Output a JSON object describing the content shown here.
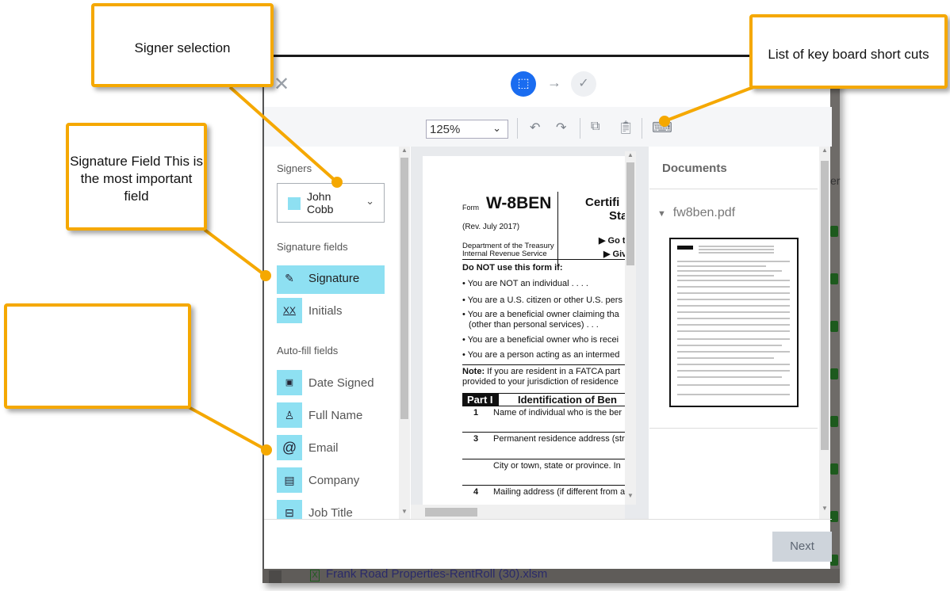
{
  "background": {
    "file_name": "Frank Road Properties-RentRoll (30).xlsm",
    "partial_text": "er"
  },
  "header": {
    "step_current": "select-fields",
    "step_next": "review"
  },
  "toolbar": {
    "zoom": "125%"
  },
  "left_panel": {
    "signers_label": "Signers",
    "signer_name": "John Cobb",
    "signer_color": "#8ee0f2",
    "signature_fields_label": "Signature fields",
    "signature_fields": [
      {
        "label": "Signature",
        "icon": "pen-icon",
        "selected": true
      },
      {
        "label": "Initials",
        "icon": "initials-icon",
        "selected": false
      }
    ],
    "autofill_label": "Auto-fill fields",
    "autofill_fields": [
      {
        "label": "Date Signed",
        "icon": "calendar-icon"
      },
      {
        "label": "Full Name",
        "icon": "person-icon"
      },
      {
        "label": "Email",
        "icon": "at-icon"
      },
      {
        "label": "Company",
        "icon": "building-icon"
      },
      {
        "label": "Job Title",
        "icon": "briefcase-icon"
      }
    ]
  },
  "document": {
    "form_label": "Form",
    "form_name": "W-8BEN",
    "title1": "Certifi",
    "title2": "Sta",
    "rev": "(Rev. July 2017)",
    "dept1": "Department of the Treasury",
    "dept2": "Internal Revenue Service",
    "go": "▶ Go t",
    "give": "▶ Giv",
    "do_not": "Do NOT use this form if:",
    "bullets": [
      "• You are NOT an individual  .  .  .  .",
      "• You are a U.S. citizen or other U.S. pers",
      "• You are a beneficial owner claiming tha",
      "(other than personal services)  .  .  .",
      "• You are a beneficial owner who is recei",
      "• You are a person acting as an intermed"
    ],
    "note_bold": "Note:",
    "note1": " If you are resident in a FATCA part",
    "note2": "provided to your jurisdiction of residence",
    "part": "Part I",
    "part_title": "Identification of Ben",
    "lines": [
      {
        "n": "1",
        "t": "Name of individual who is the ber"
      },
      {
        "n": "3",
        "t": "Permanent residence address (str"
      },
      {
        "n": "",
        "t": "City or town, state or province. In"
      },
      {
        "n": "4",
        "t": "Mailing address (if different from a"
      }
    ]
  },
  "right_panel": {
    "title": "Documents",
    "file": "fw8ben.pdf"
  },
  "footer": {
    "next": "Next"
  },
  "callouts": {
    "signer": "Signer selection",
    "signature": "Signature Field This is the most important field",
    "empty": "",
    "keyboard": "List of key board short cuts"
  },
  "colors": {
    "accent": "#1a6cf0",
    "field_bg": "#8ee0f2",
    "callout_border": "#f5a800"
  }
}
